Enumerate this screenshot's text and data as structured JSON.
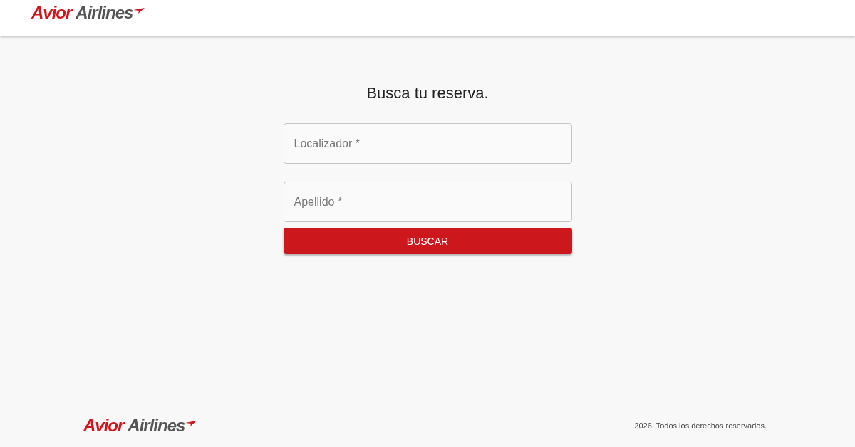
{
  "header": {
    "logo": {
      "brand": "Avior",
      "name": "Airlines"
    }
  },
  "form": {
    "title": "Busca tu reserva.",
    "fields": [
      {
        "placeholder": "Localizador *"
      },
      {
        "placeholder": "Apellido *"
      }
    ],
    "button": "BUSCAR"
  },
  "footer": {
    "logo": {
      "brand": "Avior",
      "name": "Airlines"
    },
    "copyright": "2026. Todos los derechos reservados."
  }
}
